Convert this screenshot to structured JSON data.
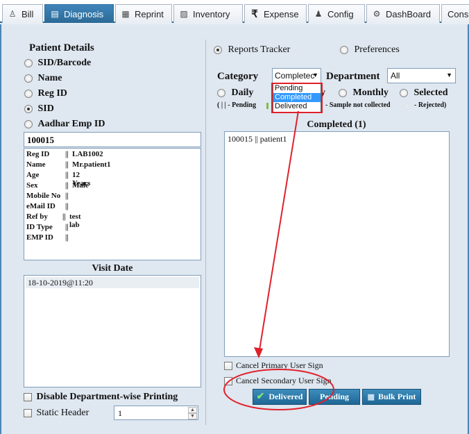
{
  "tabs": [
    {
      "label": "Bill",
      "icon": "person-icon"
    },
    {
      "label": "Diagnosis",
      "icon": "notes-icon"
    },
    {
      "label": "Reprint",
      "icon": "reprint-icon"
    },
    {
      "label": "Inventory",
      "icon": "inventory-icon"
    },
    {
      "label": "Expense",
      "icon": "rupee-icon"
    },
    {
      "label": "Config",
      "icon": "config-icon"
    },
    {
      "label": "DashBoard",
      "icon": "dashboard-icon"
    },
    {
      "label": "Consu",
      "icon": ""
    }
  ],
  "patient": {
    "title": "Patient Details",
    "options": [
      "SID/Barcode",
      "Name",
      "Reg ID",
      "SID",
      "Aadhar Emp ID"
    ],
    "selected": "SID",
    "search_value": "100015",
    "info": [
      {
        "key": "Reg ID",
        "sep": "||",
        "value": "LAB1002"
      },
      {
        "key": "Name",
        "sep": "||",
        "value": "Mr.patient1"
      },
      {
        "key": "Age",
        "sep": "||",
        "value": "12 Years"
      },
      {
        "key": "Sex",
        "sep": "||",
        "value": "Male"
      },
      {
        "key": "Mobile No",
        "sep": "||",
        "value": ""
      },
      {
        "key": "eMail ID",
        "sep": "||",
        "value": ""
      },
      {
        "key": "Ref by",
        "sep": "||",
        "value": "test lab"
      },
      {
        "key": "ID Type",
        "sep": "||",
        "value": ""
      },
      {
        "key": "EMP ID",
        "sep": "||",
        "value": ""
      }
    ],
    "visit_title": "Visit Date",
    "visit_item": "18-10-2019@11:20",
    "disable_label": "Disable Department-wise Printing",
    "static_header_label": "Static Header",
    "static_header_value": "1"
  },
  "right": {
    "reports_tracker": "Reports Tracker",
    "preferences": "Preferences",
    "category_label": "Category",
    "category_value": "Completec",
    "category_options": [
      "Pending",
      "Completed",
      "Delivered"
    ],
    "department_label": "Department",
    "department_value": "All",
    "periods": {
      "daily": "Daily",
      "weekly_tail": "y",
      "monthly": "Monthly",
      "selected": "Selected"
    },
    "legend": {
      "pending": "( | | - Pending",
      "not_collected": "- Sample not collected",
      "rejected": "- Rejected)"
    },
    "completed_title": "Completed (1)",
    "list_item": "100015 || patient1",
    "cancel_primary": "Cancel Primary User Sign",
    "cancel_secondary": "Cancel Secondary User Sign",
    "btn_delivered": "Delivered",
    "btn_pending": "Pending",
    "btn_bulk": "Bulk Print"
  },
  "colors": {
    "accent": "#2b6a96",
    "button": "#1f6796",
    "annotation": "#e0202a",
    "selection": "#3399ff"
  }
}
